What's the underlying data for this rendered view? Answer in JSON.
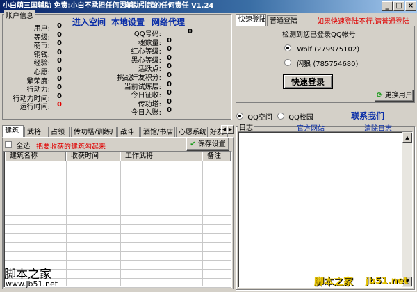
{
  "window": {
    "title": "小白萌三国辅助  免责:小白不承担任何因辅助引起的任何责任  V1.24",
    "min_label": "_",
    "max_label": "□",
    "close_label": "×"
  },
  "account": {
    "group_label": "账户信息",
    "links": [
      "进入空间",
      "本地设置",
      "网络代理"
    ],
    "left_stats": [
      {
        "label": "用户:",
        "value": "0"
      },
      {
        "label": "等级:",
        "value": "0"
      },
      {
        "label": "萌币:",
        "value": "0"
      },
      {
        "label": "铜钱:",
        "value": "0"
      },
      {
        "label": "经验:",
        "value": "0"
      },
      {
        "label": "心愿:",
        "value": "0"
      },
      {
        "label": "繁荣度:",
        "value": "0"
      },
      {
        "label": "行动力:",
        "value": "0"
      },
      {
        "label": "行动力时间:",
        "value": "0"
      },
      {
        "label": "运行时间:",
        "value": "0"
      }
    ],
    "right_stats": [
      {
        "label": "QQ号码:",
        "value": "0"
      },
      {
        "label": "魂数量:",
        "value": "0"
      },
      {
        "label": "红心等级:",
        "value": "0"
      },
      {
        "label": "黑心等级:",
        "value": "0"
      },
      {
        "label": "活跃点:",
        "value": "0"
      },
      {
        "label": "挑战奸友积分:",
        "value": "0"
      },
      {
        "label": "当前试炼层:",
        "value": "0"
      },
      {
        "label": "今日征收:",
        "value": "0"
      },
      {
        "label": "传功塔:",
        "value": "0"
      },
      {
        "label": "今日入账:",
        "value": "0"
      }
    ]
  },
  "building_tabs": [
    "建筑",
    "武将",
    "占领",
    "传功塔/训练厂",
    "战斗",
    "酒馆/书店",
    "心愿系统",
    "好友"
  ],
  "building_panel": {
    "select_all_label": "全选",
    "hint": "把要收获的建筑勾起来",
    "save_label": "保存设置",
    "columns": [
      "建筑名称",
      "收获时间",
      "工作武将",
      "备注"
    ]
  },
  "login": {
    "tabs": [
      "快速登陆",
      "普通登陆"
    ],
    "warning": "如果快速登陆不行,请普通登陆",
    "detect_text": "检测到您已登录QQ帐号",
    "accounts": [
      {
        "name": "Wolf (279975102)",
        "selected": true
      },
      {
        "name": "闪狼 (785754680)",
        "selected": false
      }
    ],
    "quick_login_label": "快速登录",
    "switch_label": "更换用户"
  },
  "mode": {
    "options": [
      "QQ空间",
      "QQ校园"
    ],
    "selected": "QQ空间",
    "contact_label": "联系我们"
  },
  "log": {
    "group_label": "日志",
    "official_site": "官方网站",
    "clear_label": "清除日志"
  },
  "watermarks": {
    "left_title": "脚本之家",
    "left_url": "www.jb51.net",
    "right_title": "脚本之家",
    "right_url": "jb51.net"
  }
}
